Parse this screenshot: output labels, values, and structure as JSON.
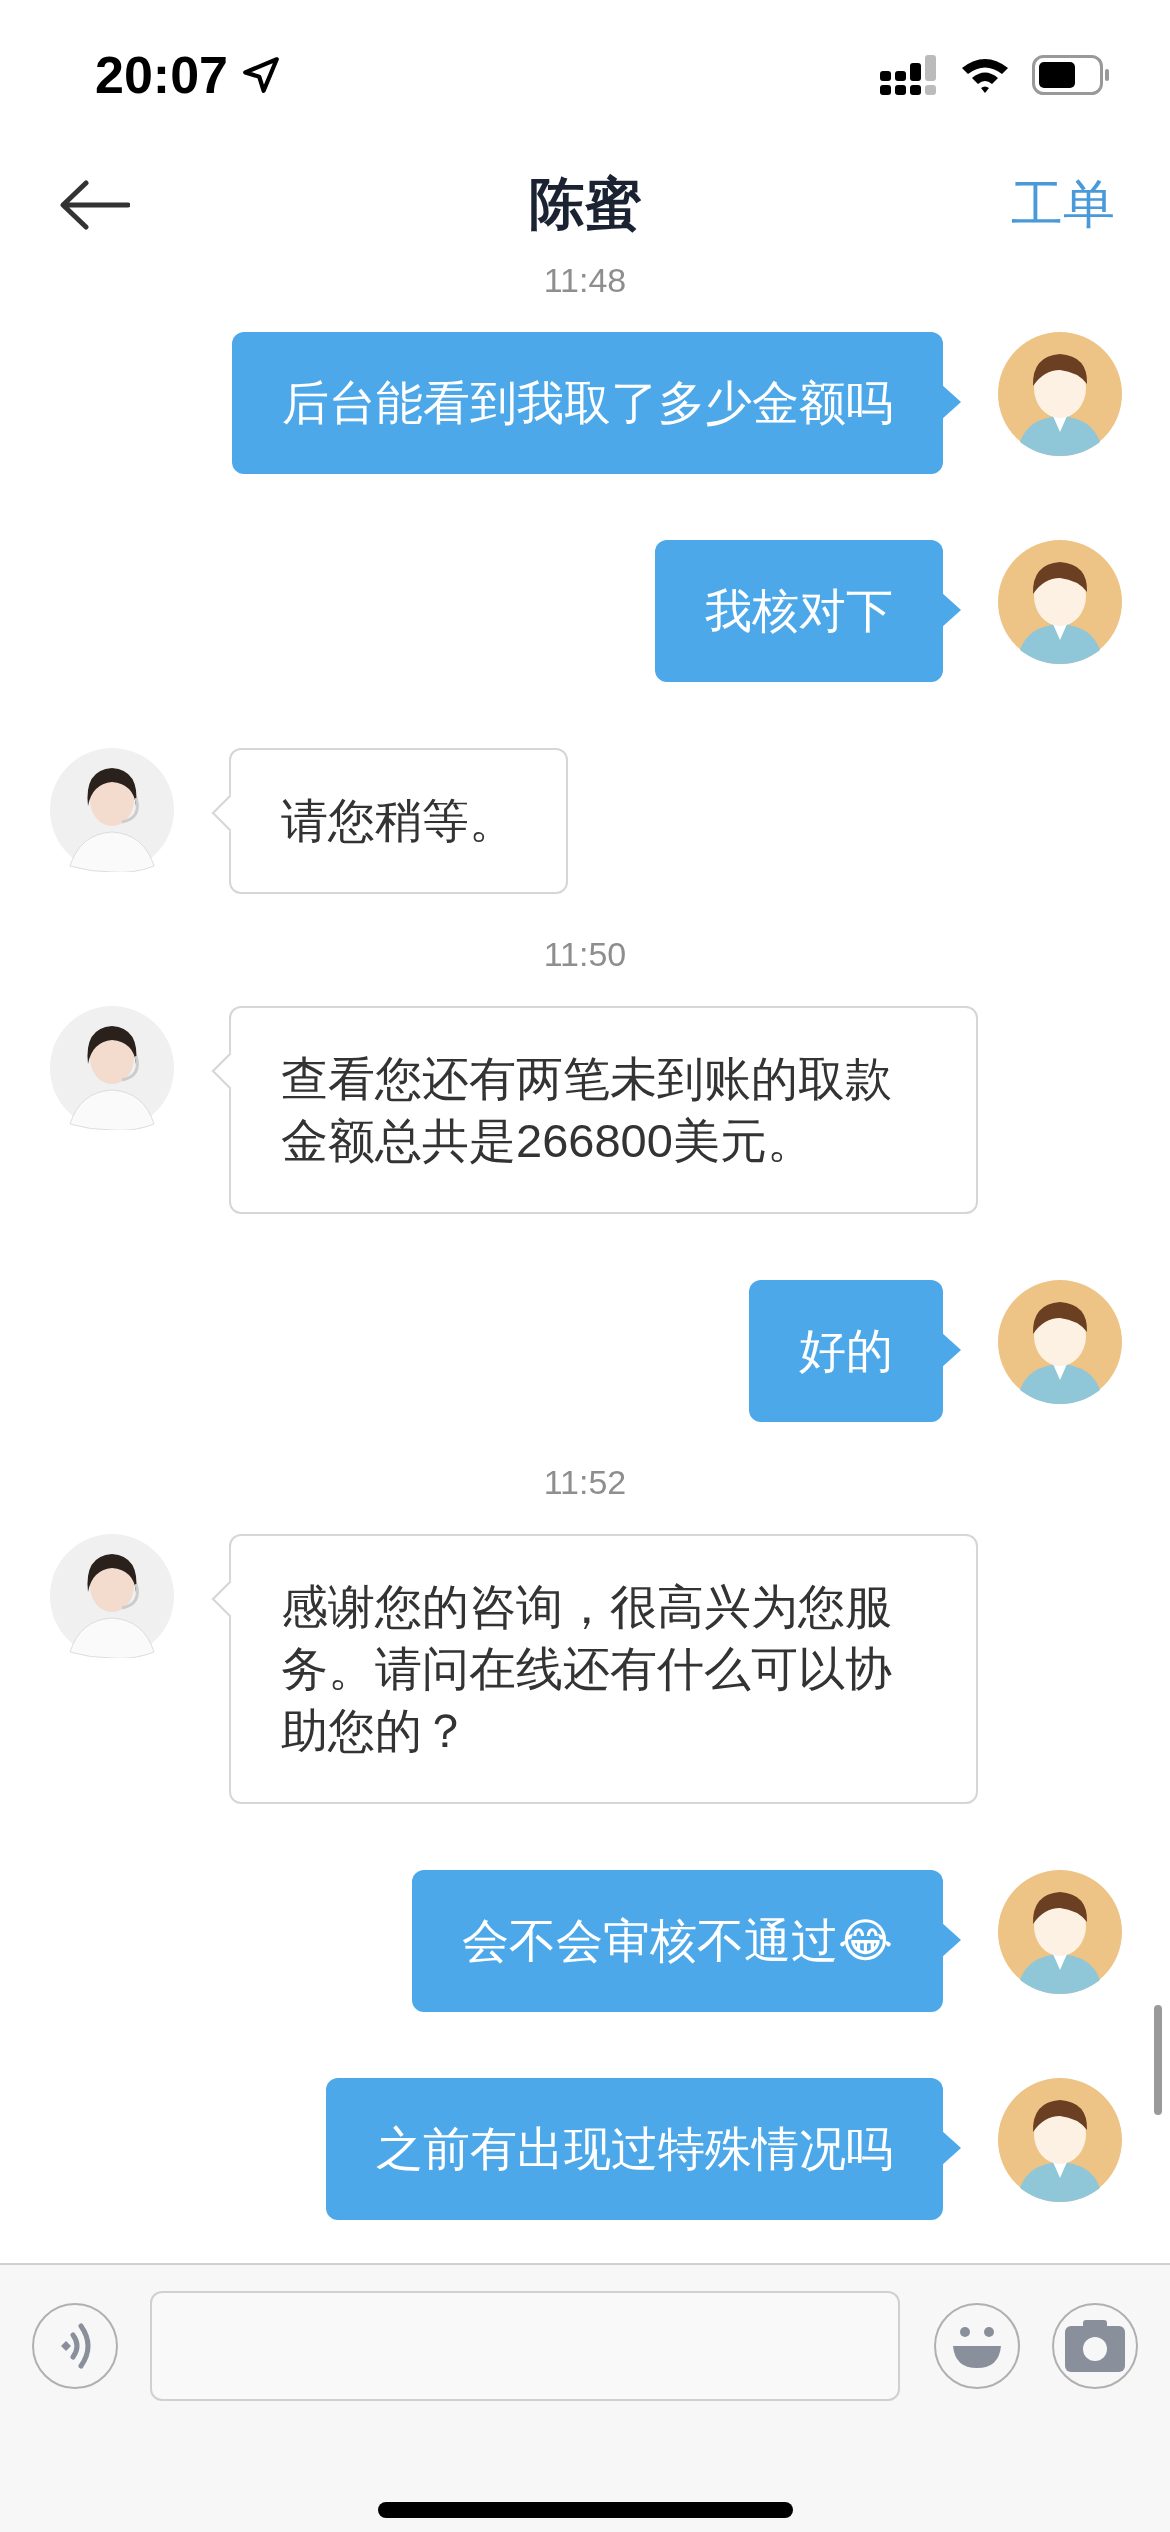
{
  "status_bar": {
    "time": "20:07"
  },
  "header": {
    "title": "陈蜜",
    "action": "工单"
  },
  "messages": [
    {
      "kind": "timestamp",
      "text": "11:48"
    },
    {
      "kind": "sent",
      "text": "后台能看到我取了多少金额吗"
    },
    {
      "kind": "sent",
      "text": "我核对下"
    },
    {
      "kind": "received",
      "text": "请您稍等。"
    },
    {
      "kind": "timestamp",
      "text": "11:50"
    },
    {
      "kind": "received",
      "text": "查看您还有两笔未到账的取款金额总共是266800美元。"
    },
    {
      "kind": "sent",
      "text": "好的"
    },
    {
      "kind": "timestamp",
      "text": "11:52"
    },
    {
      "kind": "received",
      "text": "感谢您的咨询，很高兴为您服务。请问在线还有什么可以协助您的？"
    },
    {
      "kind": "sent",
      "text": "会不会审核不通过😂"
    },
    {
      "kind": "sent",
      "text": "之前有出现过特殊情况吗"
    }
  ]
}
